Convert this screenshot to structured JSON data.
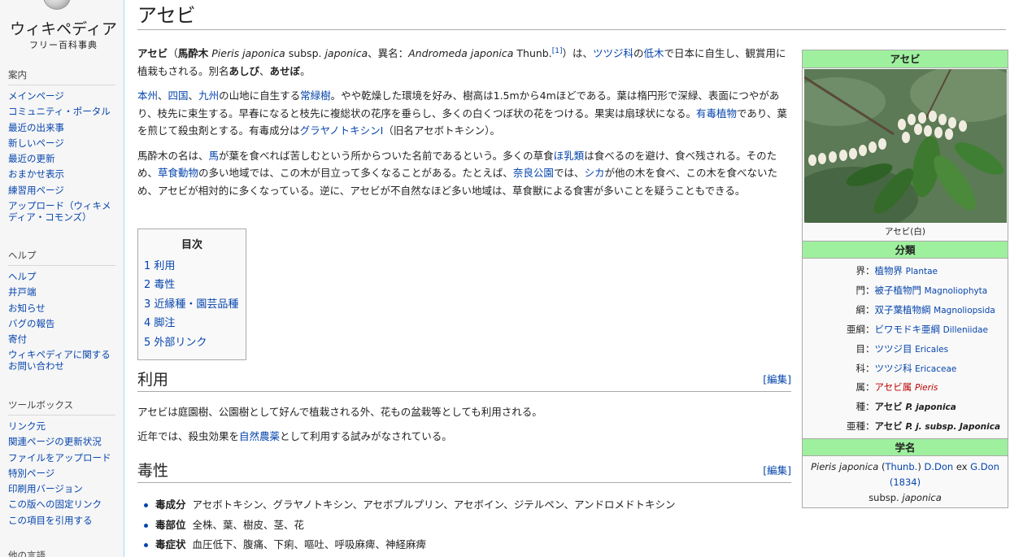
{
  "logo": {
    "title": "ウィキペディア",
    "subtitle": "フリー百科事典"
  },
  "sidebar": {
    "nav_heading": "案内",
    "nav_items": [
      "メインページ",
      "コミュニティ・ポータル",
      "最近の出来事",
      "新しいページ",
      "最近の更新",
      "おまかせ表示",
      "練習用ページ",
      "アップロード（ウィキメディア・コモンズ）"
    ],
    "help_heading": "ヘルプ",
    "help_items": [
      "ヘルプ",
      "井戸端",
      "お知らせ",
      "バグの報告",
      "寄付",
      "ウィキペディアに関するお問い合わせ"
    ],
    "tools_heading": "ツールボックス",
    "tools_items": [
      "リンク元",
      "関連ページの更新状況",
      "ファイルをアップロード",
      "特別ページ",
      "印刷用バージョン",
      "この版への固定リンク",
      "この項目を引用する"
    ],
    "other_heading": "他の言語"
  },
  "article": {
    "title": "アセビ",
    "p1": {
      "t1": "アセビ",
      "t2": "（",
      "t3": "馬酔木",
      "t4": " Pieris japonica",
      "t5": " subsp.",
      "t6": " japonica",
      "t7": "、異名：",
      "t8": "Andromeda japonica",
      "t9": " Thunb.",
      "ref": "[1]",
      "t10": "）は、",
      "l1": "ツツジ科",
      "t11": "の",
      "l2": "低木",
      "t12": "で日本に自生し、観賞用に植栽もされる。別名",
      "b1": "あしび",
      "t13": "、",
      "b2": "あせぼ",
      "t14": "。"
    },
    "p2": {
      "l1": "本州",
      "t1": "、",
      "l2": "四国",
      "t2": "、",
      "l3": "九州",
      "t3": "の山地に自生する",
      "l4": "常緑樹",
      "t4": "。やや乾燥した環境を好み、樹高は1.5mから4mほどである。葉は楕円形で深緑、表面につやがあり、枝先に束生する。早春になると枝先に複総状の花序を垂らし、多くの白くつぼ状の花をつける。果実は扇球状になる。",
      "l5": "有毒植物",
      "t5": "であり、葉を煎じて殺虫剤とする。有毒成分は",
      "l6": "グラヤノトキシンI",
      "t6": "（旧名アセボトキシン）。"
    },
    "p3": {
      "t1": "馬酔木の名は、",
      "l1": "馬",
      "t2": "が葉を食べれば苦しむという所からついた名前であるという。多くの草食",
      "l2": "ほ乳類",
      "t3": "は食べるのを避け、食べ残される。そのため、",
      "l3": "草食動物",
      "t4": "の多い地域では、この木が目立って多くなることがある。たとえば、",
      "l4": "奈良公園",
      "t5": "では、",
      "l5": "シカ",
      "t6": "が他の木を食べ、この木を食べないため、アセビが相対的に多くなっている。逆に、アセビが不自然なほど多い地域は、草食獣による食害が多いことを疑うこともできる。"
    },
    "toc": {
      "title": "目次",
      "items": [
        "1 利用",
        "2 毒性",
        "3 近縁種・園芸品種",
        "4 脚注",
        "5 外部リンク"
      ]
    },
    "edit_label": "[編集]",
    "sec1": {
      "heading": "利用",
      "p1": "アセビは庭園樹、公園樹として好んで植栽される外、花もの盆栽等としても利用される。",
      "p2_a": "近年では、殺虫効果を",
      "p2_link": "自然農薬",
      "p2_b": "として利用する試みがなされている。"
    },
    "sec2": {
      "heading": "毒性",
      "items": [
        {
          "label": "毒成分",
          "value": "アセボトキシン、グラヤノトキシン、アセボプルプリン、アセボイン、ジテルペン、アンドロメドトキシン"
        },
        {
          "label": "毒部位",
          "value": "全株、葉、樹皮、茎、花"
        },
        {
          "label": "毒症状",
          "value": "血圧低下、腹痛、下痢、嘔吐、呼吸麻痺、神経麻痺"
        }
      ]
    }
  },
  "infobox": {
    "title": "アセビ",
    "caption": "アセビ(白)",
    "classification_heading": "分類",
    "ranks": [
      {
        "rank": "界",
        "ja": "植物界",
        "sci": "Plantae",
        "style": "link"
      },
      {
        "rank": "門",
        "ja": "被子植物門",
        "sci": "Magnoliophyta",
        "style": "link"
      },
      {
        "rank": "綱",
        "ja": "双子葉植物綱",
        "sci": "Magnoliopsida",
        "style": "link"
      },
      {
        "rank": "亜綱",
        "ja": "ビワモドキ亜綱",
        "sci": "Dilleniidae",
        "style": "link"
      },
      {
        "rank": "目",
        "ja": "ツツジ目",
        "sci": "Ericales",
        "style": "link"
      },
      {
        "rank": "科",
        "ja": "ツツジ科",
        "sci": "Ericaceae",
        "style": "link"
      },
      {
        "rank": "属",
        "ja": "アセビ属",
        "sci": "Pieris",
        "style": "red"
      },
      {
        "rank": "種",
        "ja": "アセビ",
        "sci": "P. japonica",
        "style": "bold"
      },
      {
        "rank": "亜種",
        "ja": "アセビ",
        "sci": "P. j. subsp. Japonica",
        "style": "bold"
      }
    ],
    "sep": "：",
    "sciname_heading": "学名",
    "sciname": {
      "t1": "Pieris japonica",
      "t2": " (",
      "l1": "Thunb.",
      "t3": ") ",
      "l2": "D.Don",
      "t4": " ex ",
      "l3": "G.Don",
      "l4": "(1834)",
      "t5": "subsp.",
      "t6": " japonica"
    }
  },
  "colors": {
    "link": "#0645ad",
    "redlink": "#ba0000",
    "infobox_head": "#9ef09e"
  }
}
